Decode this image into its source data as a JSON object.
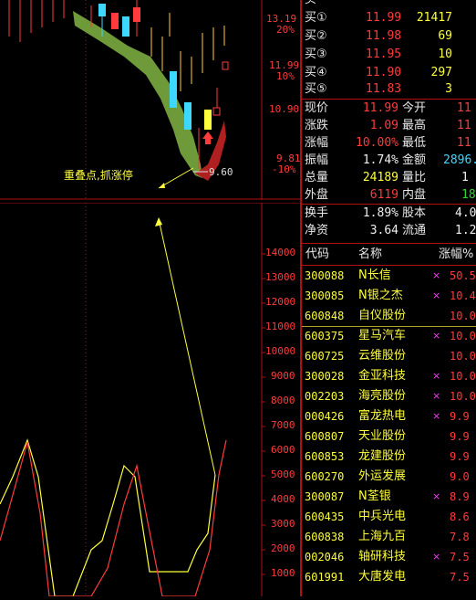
{
  "kline_chart": {
    "price_labels": [
      "13.19",
      "20%",
      "11.99",
      "10%",
      "10.90",
      "9.81",
      "-10%"
    ],
    "low_marker": "9.60",
    "annotation": "重叠点,抓涨停"
  },
  "volume_chart": {
    "y_ticks": [
      "14000",
      "13000",
      "12000",
      "11000",
      "10000",
      "9000",
      "8000",
      "7000",
      "6000",
      "5000",
      "4000",
      "3000",
      "2000",
      "1000"
    ]
  },
  "order_book": {
    "rows": [
      {
        "label": "买①",
        "price": "11.99",
        "vol": "21417"
      },
      {
        "label": "买②",
        "price": "11.98",
        "vol": "69"
      },
      {
        "label": "买③",
        "price": "11.95",
        "vol": "10"
      },
      {
        "label": "买④",
        "price": "11.90",
        "vol": "297"
      },
      {
        "label": "买⑤",
        "price": "11.83",
        "vol": "3"
      }
    ],
    "top_partial": "买"
  },
  "quote": {
    "rows": [
      {
        "k1": "现价",
        "v1": "11.99",
        "k2": "今开",
        "v2": "11"
      },
      {
        "k1": "涨跌",
        "v1": "1.09",
        "k2": "最高",
        "v2": "11"
      },
      {
        "k1": "涨幅",
        "v1": "10.00%",
        "k2": "最低",
        "v2": "11"
      },
      {
        "k1": "振幅",
        "v1": "1.74%",
        "k2": "金额",
        "v2": "2896."
      },
      {
        "k1": "总量",
        "v1": "24189",
        "k2": "量比",
        "v2": "1"
      },
      {
        "k1": "外盘",
        "v1": "6119",
        "k2": "内盘",
        "v2": "18"
      },
      {
        "k1": "换手",
        "v1": "1.89%",
        "k2": "股本",
        "v2": "4.0"
      },
      {
        "k1": "净资",
        "v1": "3.64",
        "k2": "流通",
        "v2": "1.2"
      }
    ]
  },
  "stock_list": {
    "headers": {
      "code": "代码",
      "name": "名称",
      "pct": "涨幅%"
    },
    "rows": [
      {
        "code": "300088",
        "name": "N长信",
        "pct": "50.5",
        "mark": "×"
      },
      {
        "code": "300085",
        "name": "N银之杰",
        "pct": "10.4",
        "mark": "×"
      },
      {
        "code": "600848",
        "name": "自仪股份",
        "pct": "10.0",
        "mark": ""
      },
      {
        "code": "600375",
        "name": "星马汽车",
        "pct": "10.0",
        "mark": "×"
      },
      {
        "code": "600725",
        "name": "云维股份",
        "pct": "10.0",
        "mark": ""
      },
      {
        "code": "300028",
        "name": "金亚科技",
        "pct": "10.0",
        "mark": "×"
      },
      {
        "code": "002203",
        "name": "海亮股份",
        "pct": "10.0",
        "mark": "×"
      },
      {
        "code": "000426",
        "name": "富龙热电",
        "pct": "9.9",
        "mark": "×"
      },
      {
        "code": "600807",
        "name": "天业股份",
        "pct": "9.9",
        "mark": ""
      },
      {
        "code": "600853",
        "name": "龙建股份",
        "pct": "9.9",
        "mark": ""
      },
      {
        "code": "600270",
        "name": "外运发展",
        "pct": "9.0",
        "mark": ""
      },
      {
        "code": "300087",
        "name": "N荃银",
        "pct": "8.9",
        "mark": "×"
      },
      {
        "code": "600435",
        "name": "中兵光电",
        "pct": "8.6",
        "mark": ""
      },
      {
        "code": "600838",
        "name": "上海九百",
        "pct": "7.8",
        "mark": ""
      },
      {
        "code": "002046",
        "name": "轴研科技",
        "pct": "7.5",
        "mark": "×"
      },
      {
        "code": "601991",
        "name": "大唐发电",
        "pct": "7.5",
        "mark": ""
      }
    ]
  },
  "colors": {
    "red": "#ff3b3b",
    "yellow": "#ffff3b",
    "green": "#2bd62b",
    "cyan": "#3cd8ff",
    "bg": "#000000"
  }
}
